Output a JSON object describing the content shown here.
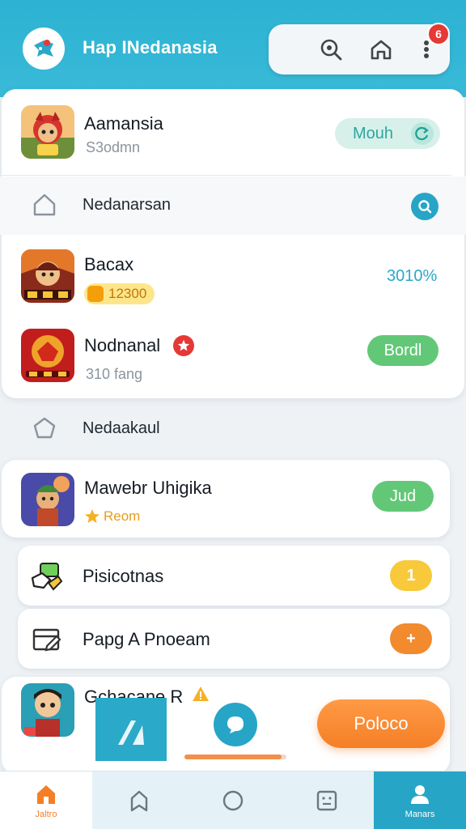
{
  "header": {
    "title": "Hap INedanasia",
    "logo_icon": "bird-logo-icon",
    "actions": [
      "search-icon",
      "home-icon",
      "more-vertical-icon"
    ],
    "notification_count": "6"
  },
  "featured": {
    "name": "Aamansia",
    "sub": "S3odmn",
    "button_label": "Mouh"
  },
  "section1": {
    "label": "Nedanarsan"
  },
  "apps1": [
    {
      "name": "Bacax",
      "tag": "12300",
      "value": "3010%"
    },
    {
      "name": "Nodnanal",
      "sub": "310 fang",
      "button_label": "Bordl"
    }
  ],
  "section2": {
    "label": "Nedaakaul"
  },
  "apps2": [
    {
      "name": "Mawebr Uhigika",
      "tag": "Reom",
      "button_label": "Jud"
    }
  ],
  "list_rows": [
    {
      "label": "Pisicotnas",
      "badge": "1",
      "color": "#f7c93b"
    },
    {
      "label": "Papg A Pnoeam",
      "badge": "+",
      "color": "#f28a2e"
    }
  ],
  "partial_app": {
    "name": "Gchacane R"
  },
  "fab": {
    "label": "Poloco"
  },
  "float_progress": 0.95,
  "bottom_nav": [
    {
      "label": "Jaltro",
      "icon": "home-icon"
    },
    {
      "label": "",
      "icon": "bookmark-icon"
    },
    {
      "label": "",
      "icon": "circle-icon"
    },
    {
      "label": "",
      "icon": "face-icon"
    },
    {
      "label": "Manars",
      "icon": "person-icon"
    }
  ],
  "colors": {
    "header": "#2cb2d2",
    "accent_teal": "#27a5c7",
    "green": "#62c878",
    "orange": "#f47f27"
  }
}
